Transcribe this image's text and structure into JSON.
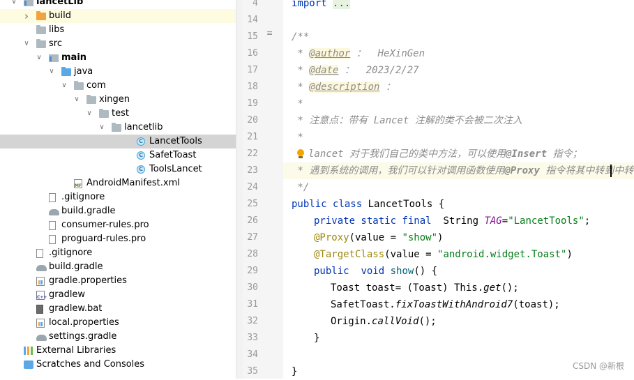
{
  "tree": [
    {
      "label": "lancetLib",
      "icon": "module-icon",
      "bold": true,
      "arrow": "v",
      "indent": 0,
      "state": ""
    },
    {
      "label": "build",
      "icon": "folder-orange-icon",
      "bold": false,
      "arrow": ">",
      "indent": 1,
      "state": "hover"
    },
    {
      "label": "libs",
      "icon": "folder-icon",
      "bold": false,
      "arrow": "",
      "indent": 1,
      "state": ""
    },
    {
      "label": "src",
      "icon": "folder-icon",
      "bold": false,
      "arrow": "v",
      "indent": 1,
      "state": ""
    },
    {
      "label": "main",
      "icon": "module-icon",
      "bold": true,
      "arrow": "v",
      "indent": 2,
      "state": ""
    },
    {
      "label": "java",
      "icon": "folder-blue-icon",
      "bold": false,
      "arrow": "v",
      "indent": 3,
      "state": ""
    },
    {
      "label": "com",
      "icon": "folder-icon",
      "bold": false,
      "arrow": "v",
      "indent": 4,
      "state": ""
    },
    {
      "label": "xingen",
      "icon": "folder-icon",
      "bold": false,
      "arrow": "v",
      "indent": 5,
      "state": ""
    },
    {
      "label": "test",
      "icon": "folder-icon",
      "bold": false,
      "arrow": "v",
      "indent": 6,
      "state": ""
    },
    {
      "label": "lancetlib",
      "icon": "folder-icon",
      "bold": false,
      "arrow": "v",
      "indent": 7,
      "state": ""
    },
    {
      "label": "LancetTools",
      "icon": "class-icon",
      "bold": false,
      "arrow": "",
      "indent": 9,
      "state": "selected"
    },
    {
      "label": "SafetToast",
      "icon": "class-icon",
      "bold": false,
      "arrow": "",
      "indent": 9,
      "state": ""
    },
    {
      "label": "ToolsLancet",
      "icon": "class-icon",
      "bold": false,
      "arrow": "",
      "indent": 9,
      "state": ""
    },
    {
      "label": "AndroidManifest.xml",
      "icon": "manifest-icon",
      "bold": false,
      "arrow": "",
      "indent": 4,
      "state": ""
    },
    {
      "label": ".gitignore",
      "icon": "gitignore-icon",
      "bold": false,
      "arrow": "",
      "indent": 2,
      "state": ""
    },
    {
      "label": "build.gradle",
      "icon": "gradle-icon",
      "bold": false,
      "arrow": "",
      "indent": 2,
      "state": ""
    },
    {
      "label": "consumer-rules.pro",
      "icon": "file-icon",
      "bold": false,
      "arrow": "",
      "indent": 2,
      "state": ""
    },
    {
      "label": "proguard-rules.pro",
      "icon": "file-icon",
      "bold": false,
      "arrow": "",
      "indent": 2,
      "state": ""
    },
    {
      "label": ".gitignore",
      "icon": "gitignore-icon",
      "bold": false,
      "arrow": "",
      "indent": 1,
      "state": ""
    },
    {
      "label": "build.gradle",
      "icon": "gradle-icon",
      "bold": false,
      "arrow": "",
      "indent": 1,
      "state": ""
    },
    {
      "label": "gradle.properties",
      "icon": "properties-icon",
      "bold": false,
      "arrow": "",
      "indent": 1,
      "state": ""
    },
    {
      "label": "gradlew",
      "icon": "cpp-file-icon",
      "bold": false,
      "arrow": "",
      "indent": 1,
      "state": ""
    },
    {
      "label": "gradlew.bat",
      "icon": "file-dark-icon",
      "bold": false,
      "arrow": "",
      "indent": 1,
      "state": ""
    },
    {
      "label": "local.properties",
      "icon": "properties-icon",
      "bold": false,
      "arrow": "",
      "indent": 1,
      "state": ""
    },
    {
      "label": "settings.gradle",
      "icon": "gradle-icon",
      "bold": false,
      "arrow": "",
      "indent": 1,
      "state": ""
    },
    {
      "label": "External Libraries",
      "icon": "libraries-icon",
      "bold": false,
      "arrow": "",
      "indent": 0,
      "state": ""
    },
    {
      "label": "Scratches and Consoles",
      "icon": "scratches-icon",
      "bold": false,
      "arrow": "",
      "indent": 0,
      "state": ""
    }
  ],
  "editor": {
    "line_numbers": [
      "4",
      "14",
      "15",
      "16",
      "17",
      "18",
      "19",
      "20",
      "21",
      "22",
      "23",
      "24",
      "25",
      "26",
      "27",
      "28",
      "29",
      "30",
      "31",
      "32",
      "33",
      "34",
      "35"
    ],
    "lines": {
      "l4_import": "import",
      "l4_dots": "...",
      "l15": "/**",
      "l16_star": " * ",
      "l16_tag": "@author",
      "l16_val": " ：  HeXinGen",
      "l17_star": " * ",
      "l17_tag": "@date",
      "l17_val": " ：  2023/2/27",
      "l18_star": " * ",
      "l18_tag": "@description",
      "l18_val": " ：",
      "l19": " *",
      "l20": " * 注意点：带有 Lancet 注解的类不会被二次注入",
      "l21": " *",
      "l22_pre": " ",
      "l22_a": "lancet 对于我们自己的类中方法，可以使用",
      "l22_b": "@Insert",
      "l22_c": " 指令；",
      "l23_a": " * 遇到系统的调用，我们可以针对调用函数使用",
      "l23_b": "@Proxy",
      "l23_c": " 指令将其中转到中转函",
      "l24": " */",
      "l25_kw1": "public",
      "l25_kw2": "class",
      "l25_name": "LancetTools",
      "l25_brace": " {",
      "l26_kw": "private static final",
      "l26_type": "String",
      "l26_field": "TAG",
      "l26_eq": "=",
      "l26_str": "\"LancetTools\"",
      "l26_end": ";",
      "l27_ann": "@Proxy",
      "l27_open": "(value = ",
      "l27_str": "\"show\"",
      "l27_close": ")",
      "l28_ann": "@TargetClass",
      "l28_open": "(value = ",
      "l28_str": "\"android.widget.Toast\"",
      "l28_close": ")",
      "l29_kw1": "public",
      "l29_kw2": "void",
      "l29_name": "show",
      "l29_rest": "() {",
      "l30_a": "Toast toast= (Toast) This.",
      "l30_b": "get",
      "l30_c": "();",
      "l31_a": "SafetToast.",
      "l31_b": "fixToastWithAndroid7",
      "l31_c": "(toast);",
      "l32_a": "Origin.",
      "l32_b": "callVoid",
      "l32_c": "();",
      "l33": "}",
      "l35": "}"
    }
  },
  "watermark": "CSDN @新根",
  "colors": {
    "keyword": "#0033b3",
    "string": "#067d17",
    "annotation": "#9e880d",
    "comment": "#8c8c8c",
    "field": "#871094",
    "selection": "#d4d4d4"
  }
}
